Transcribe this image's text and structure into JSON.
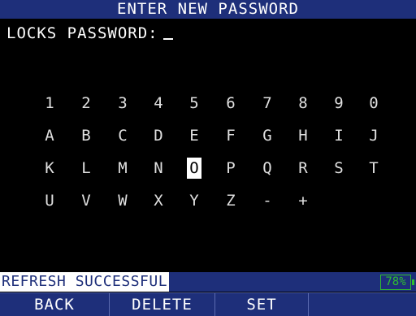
{
  "title": "ENTER NEW PASSWORD",
  "prompt": {
    "label": "LOCKS PASSWORD:",
    "value": ""
  },
  "keyboard": {
    "rows": [
      [
        "1",
        "2",
        "3",
        "4",
        "5",
        "6",
        "7",
        "8",
        "9",
        "0"
      ],
      [
        "A",
        "B",
        "C",
        "D",
        "E",
        "F",
        "G",
        "H",
        "I",
        "J"
      ],
      [
        "K",
        "L",
        "M",
        "N",
        "O",
        "P",
        "Q",
        "R",
        "S",
        "T"
      ],
      [
        "U",
        "V",
        "W",
        "X",
        "Y",
        "Z",
        "-",
        "+"
      ]
    ],
    "selected": "O"
  },
  "status": {
    "message": "REFRESH SUCCESSFUL",
    "battery": "78%"
  },
  "softkeys": [
    "BACK",
    "DELETE",
    "SET",
    "",
    ""
  ],
  "colors": {
    "bar": "#1e2f7a",
    "battery": "#2fbf2f"
  }
}
